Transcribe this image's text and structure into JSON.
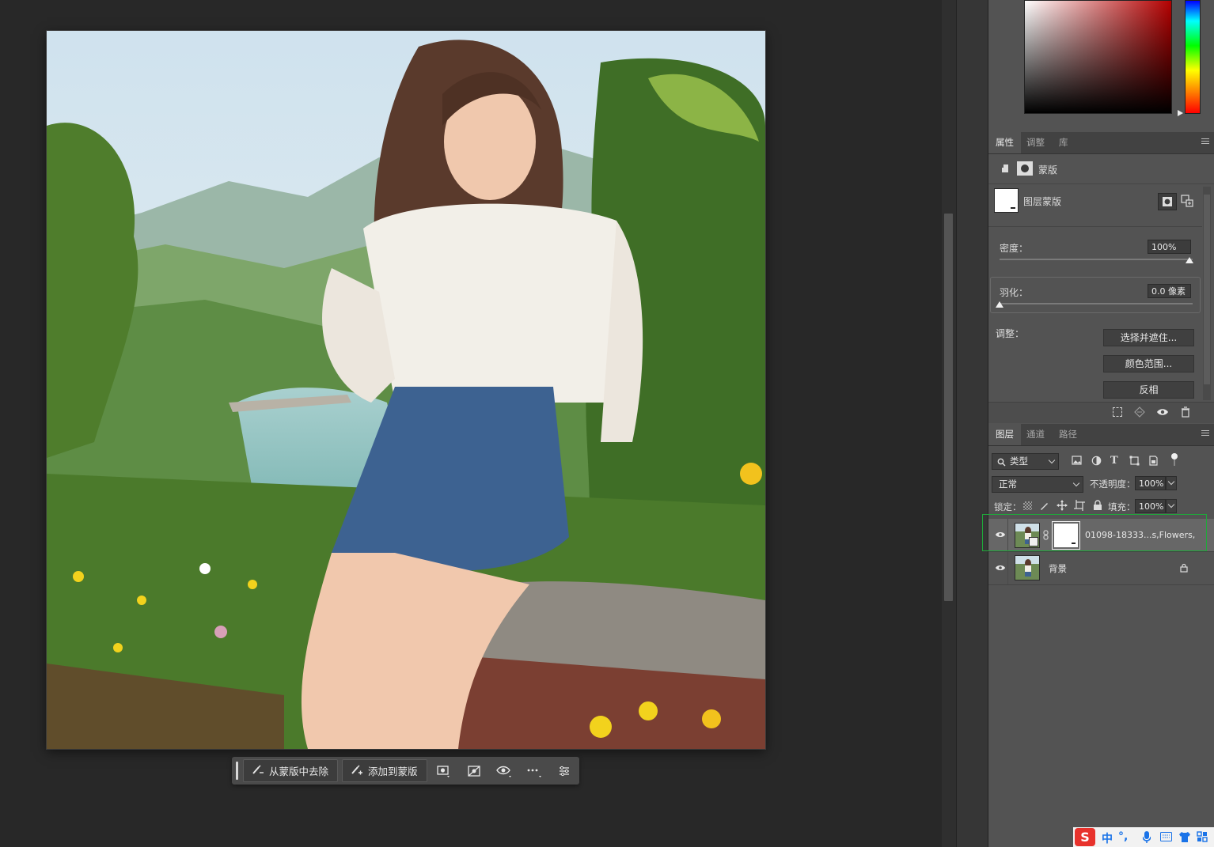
{
  "canvas": {
    "photo_subject": "",
    "taskbar": {
      "remove_from_mask": "从蒙版中去除",
      "add_to_mask": "添加到蒙版",
      "icons": [
        "mask-options-icon",
        "disable-mask-icon",
        "mask-visibility-icon",
        "more-options-icon",
        "settings-sliders-icon"
      ]
    }
  },
  "properties_panel": {
    "tabs": [
      "属性",
      "调整",
      "库"
    ],
    "active_tab": "属性",
    "mask_label": "蒙版",
    "layer_mask_label": "图层蒙版",
    "density_label": "密度：",
    "density_value": "100%",
    "density_level": 1.0,
    "feather_label": "羽化：",
    "feather_value": "0.0 像素",
    "feather_level": 0.0,
    "adjust_label": "调整：",
    "buttons": [
      "选择并遮住...",
      "颜色范围...",
      "反相"
    ]
  },
  "layers_panel": {
    "tabs": [
      "图层",
      "通道",
      "路径"
    ],
    "active_tab": "图层",
    "filter_kind": "类型",
    "blend_mode": "正常",
    "opacity_label": "不透明度：",
    "opacity_value": "100%",
    "lock_label": "锁定：",
    "fill_label": "填充：",
    "fill_value": "100%",
    "layers": [
      {
        "name": "01098-18333...s,Flowers,",
        "selected": true,
        "has_mask": true
      },
      {
        "name": "背景",
        "selected": false,
        "locked": true
      }
    ]
  },
  "colors": {
    "accent_selection": "#1fa83a",
    "canvas_bg": "#282828",
    "panel_bg": "#535353"
  },
  "ime": {
    "logo": "S",
    "mode": "中"
  }
}
